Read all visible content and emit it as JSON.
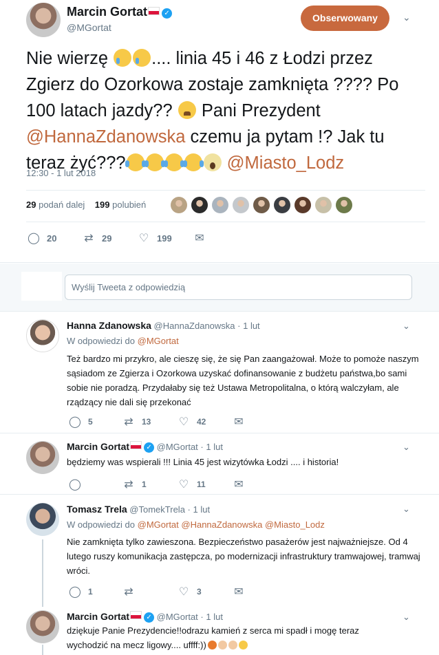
{
  "main_tweet": {
    "author_name": "Marcin Gortat",
    "author_handle": "@MGortat",
    "follow_label": "Obserwowany",
    "text_part1": "Nie wierzę ",
    "text_part2": ".... linia 45 i 46 z Łodzi przez Zgierz do Ozorkowa zostaje zamknięta ???? Po 100 latach jazdy?? ",
    "text_part3": " Pani Prezydent ",
    "mention1": "@HannaZdanowska",
    "text_part4": " czemu ja pytam !? Jak tu teraz żyć???",
    "mention2": "@Miasto_Lodz",
    "timestamp": "12:30 - 1 lut 2018",
    "retweets_count": "29",
    "retweets_label": "podań dalej",
    "likes_count": "199",
    "likes_label": "polubień",
    "liker_colors": [
      "#b9a384",
      "#2b2b2b",
      "#aab4be",
      "#c4c8cc",
      "#6f5b48",
      "#3a3d42",
      "#5a3a2a",
      "#c7c0a8",
      "#6d7a4a"
    ],
    "actions": {
      "replies": "20",
      "retweets": "29",
      "likes": "199"
    }
  },
  "reply_box": {
    "placeholder": "Wyślij Tweeta z odpowiedzią"
  },
  "replies": [
    {
      "name": "Hanna Zdanowska",
      "handle": "@HannaZdanowska",
      "time": "· 1 lut",
      "in_reply_label": "W odpowiedzi do",
      "in_reply_to": "@MGortat",
      "text": "Też bardzo mi przykro, ale cieszę się, że się Pan zaangażował. Może to pomoże naszym sąsiadom ze Zgierza i Ozorkowa uzyskać dofinansowanie z budżetu państwa,bo sami sobie nie poradzą. Przydałaby się też Ustawa Metropolitalna, o którą walczyłam, ale rządzący nie dali się przekonać",
      "replies": "5",
      "retweets": "13",
      "likes": "42"
    },
    {
      "name": "Marcin Gortat",
      "handle": "@MGortat",
      "time": "· 1 lut",
      "text": "będziemy was wspierali !!! Linia 45 jest wizytówka Łodzi .... i historia!",
      "replies": "",
      "retweets": "1",
      "likes": "11"
    },
    {
      "name": "Tomasz Trela",
      "handle": "@TomekTrela",
      "time": "· 1 lut",
      "in_reply_label": "W odpowiedzi do",
      "in_reply_to": "@MGortat @HannaZdanowska @Miasto_Lodz",
      "text": "Nie zamknięta tylko zawieszona. Bezpieczeństwo pasażerów jest najważniejsze. Od 4 lutego ruszy komunikacja zastępcza, po modernizacji infrastruktury tramwajowej, tramwaj wróci.",
      "replies": "1",
      "retweets": "",
      "likes": "3"
    },
    {
      "name": "Marcin Gortat",
      "handle": "@MGortat",
      "time": "· 1 lut",
      "text_line1": "dziękuje Panie Prezydencie!!odrazu kamień z serca mi spadł  i mogę teraz",
      "text_line2": "wychodzić na mecz ligowy.... uffff:))"
    }
  ],
  "colors": {
    "accent": "#c8693e",
    "verified": "#1da1f2",
    "muted": "#657786"
  },
  "icons": [
    "reply-icon",
    "retweet-icon",
    "like-icon",
    "message-icon",
    "chevron-down-icon",
    "verified-icon"
  ]
}
